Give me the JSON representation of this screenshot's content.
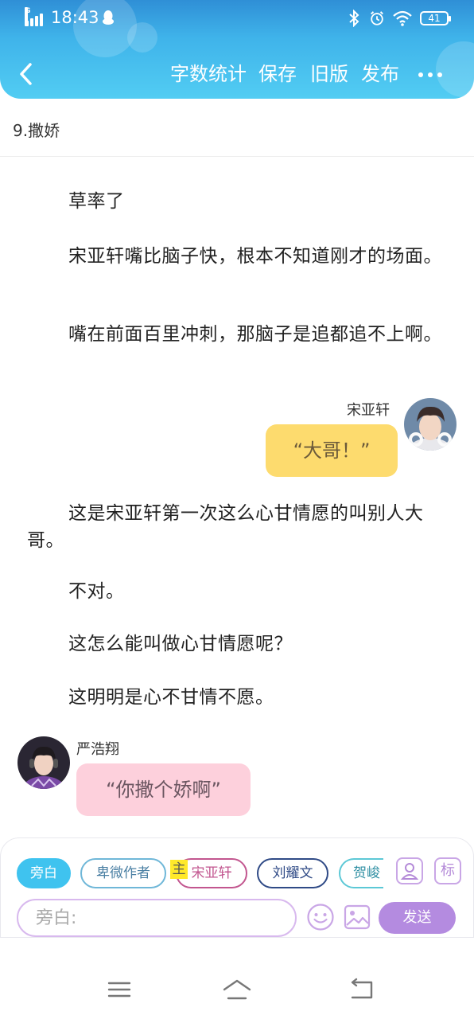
{
  "status_bar": {
    "time": "18:43",
    "network_label": "G",
    "battery": "41",
    "icons": [
      "signal-icon",
      "qq-penguin-icon",
      "bluetooth-icon",
      "alarm-icon",
      "wifi-icon",
      "battery-icon"
    ]
  },
  "toolbar": {
    "back_icon": "chevron-left-icon",
    "word_count": "字数统计",
    "save": "保存",
    "old_version": "旧版",
    "publish": "发布",
    "more_icon": "more-dots-icon"
  },
  "chapter": {
    "title": "9.撒娇"
  },
  "content": {
    "para1": "草率了",
    "para2": "宋亚轩嘴比脑子快，根本不知道刚才的场面。",
    "para3": "嘴在前面百里冲刺，那脑子是追都追不上啊。",
    "dialog1": {
      "speaker": "宋亚轩",
      "text": "“大哥！”"
    },
    "para4": "这是宋亚轩第一次这么心甘情愿的叫别人大哥。",
    "para5": "不对。",
    "para6": "这怎么能叫做心甘情愿呢？",
    "para7": "这明明是心不甘情不愿。",
    "dialog2": {
      "speaker": "严浩翔",
      "text": "“你撒个娇啊”"
    }
  },
  "input_panel": {
    "chips": [
      {
        "label": "旁白",
        "selected": true
      },
      {
        "label": "卑微作者"
      },
      {
        "label": "宋亚轩",
        "host_badge": "主"
      },
      {
        "label": "刘耀文"
      },
      {
        "label": "贺峻"
      }
    ],
    "character_icon": "person-icon",
    "tag_label": "标",
    "input_placeholder": "旁白:",
    "emoji_icon": "emoji-smile-icon",
    "image_icon": "image-icon",
    "send": "发送"
  },
  "nav": {
    "icons": [
      "menu-icon",
      "home-icon",
      "back-icon"
    ]
  },
  "colors": {
    "header_gradient": [
      "#2f8fd6",
      "#52cdf3"
    ],
    "narration_chip": "#3fc3ef",
    "yellow_bubble": "#fddb6e",
    "pink_bubble": "#fdd0dc",
    "send_button": "#b48be0"
  }
}
